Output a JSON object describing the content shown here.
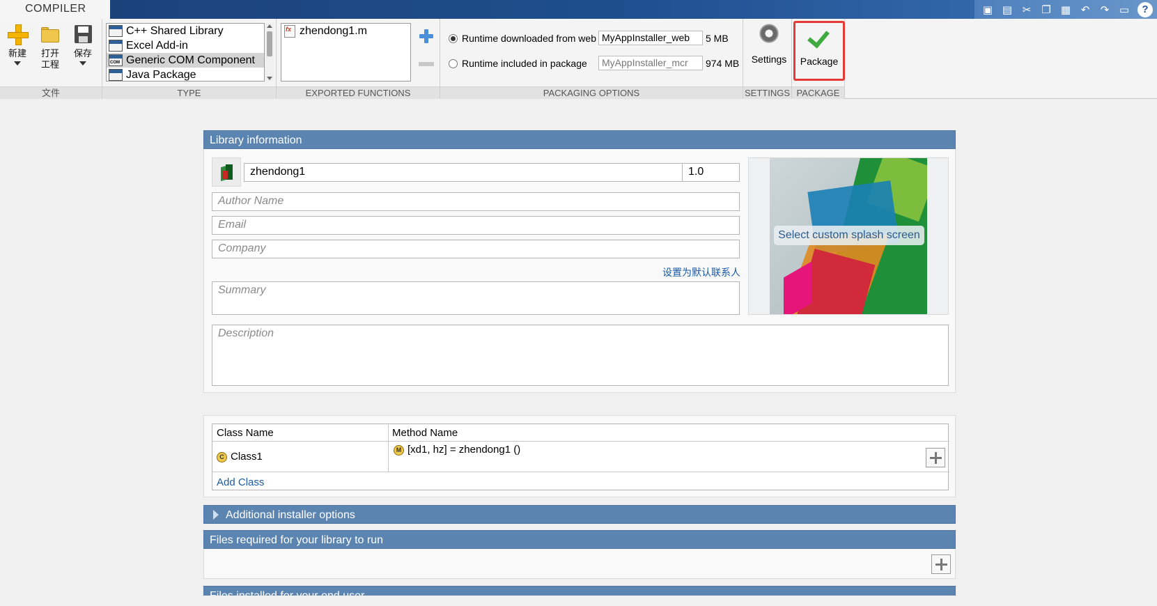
{
  "app": {
    "tab": "COMPILER",
    "quick_access": [
      "new-file-icon",
      "save-icon",
      "cut-icon",
      "copy-icon",
      "paste-icon",
      "undo-icon",
      "redo-icon",
      "layout-icon",
      "help-icon"
    ],
    "help_glyph": "?"
  },
  "ribbon": {
    "file_group": {
      "label": "文件",
      "new_label": "新建",
      "open_label": "打开\n工程",
      "save_label": "保存"
    },
    "type_group": {
      "label": "TYPE",
      "items": [
        {
          "label": "C++ Shared Library",
          "selected": false
        },
        {
          "label": "Excel Add-in",
          "selected": false
        },
        {
          "label": "Generic COM Component",
          "selected": true
        },
        {
          "label": "Java Package",
          "selected": false
        }
      ]
    },
    "exported_group": {
      "label": "EXPORTED FUNCTIONS",
      "files": [
        "zhendong1.m"
      ]
    },
    "packaging_group": {
      "label": "PACKAGING OPTIONS",
      "runtime_web_label": "Runtime downloaded from web",
      "runtime_web_value": "MyAppInstaller_web",
      "runtime_web_size": "5 MB",
      "runtime_pkg_label": "Runtime included in package",
      "runtime_pkg_value": "MyAppInstaller_mcr",
      "runtime_pkg_size": "974 MB"
    },
    "settings_group": {
      "label": "SETTINGS",
      "button": "Settings"
    },
    "package_group": {
      "label": "PACKAGE",
      "button": "Package"
    }
  },
  "library": {
    "header": "Library information",
    "name": "zhendong1",
    "version": "1.0",
    "author_placeholder": "Author Name",
    "email_placeholder": "Email",
    "company_placeholder": "Company",
    "set_default_contact": "设置为默认联系人",
    "summary_placeholder": "Summary",
    "description_placeholder": "Description",
    "splash_button": "Select custom splash screen"
  },
  "classes": {
    "col_class": "Class Name",
    "col_method": "Method Name",
    "rows": [
      {
        "class_name": "Class1",
        "method": "[xd1, hz] = zhendong1 ()"
      }
    ],
    "add_class": "Add Class",
    "class_badge": "C",
    "method_badge": "M"
  },
  "sections": {
    "additional_installer": "Additional installer options",
    "files_required": "Files required for your library to run",
    "files_installed": "Files installed for your end user"
  },
  "colors": {
    "section_header": "#5b84b1",
    "title_bar": "#1f4f8e",
    "package_highlight": "#e53935",
    "link": "#1a5aa6"
  }
}
